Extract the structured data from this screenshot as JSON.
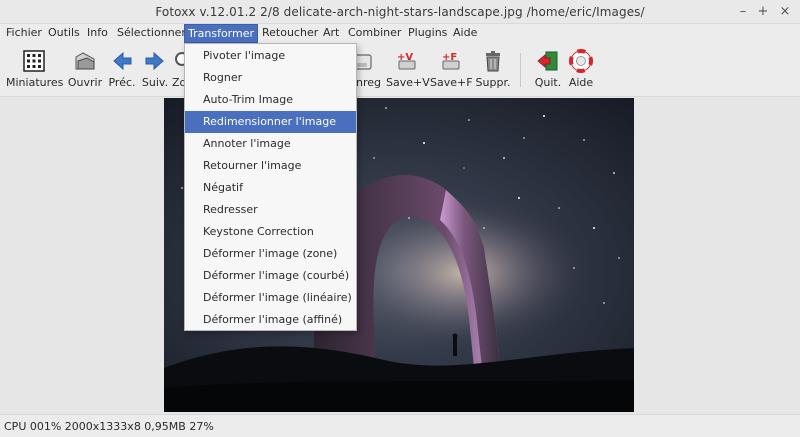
{
  "window": {
    "title": "Fotoxx v.12.01.2  2/8  delicate-arch-night-stars-landscape.jpg  /home/eric/Images/",
    "controls": [
      "–",
      "+",
      "×"
    ]
  },
  "menubar": [
    "Fichier",
    "Outils",
    "Info",
    "Sélectionner",
    "Transformer",
    "Retoucher",
    "Art",
    "Combiner",
    "Plugins",
    "Aide"
  ],
  "toolbar": {
    "miniatures": "Miniatures",
    "ouvrir": "Ouvrir",
    "prec": "Préc.",
    "suiv": "Suiv.",
    "zoom_partial": "Zo",
    "enreg_partial": "nreg.",
    "save_v": "Save+V",
    "save_f": "Save+F",
    "suppr": "Suppr.",
    "quit": "Quit.",
    "aide": "Aide"
  },
  "dropdown": {
    "items": [
      "Pivoter l'image",
      "Rogner",
      "Auto-Trim Image",
      "Redimensionner l'image",
      "Annoter l'image",
      "Retourner l'image",
      "Négatif",
      "Redresser",
      "Keystone Correction",
      "Déformer l'image (zone)",
      "Déformer l'image (courbé)",
      "Déformer l'image (linéaire)",
      "Déformer l'image (affiné)"
    ],
    "highlighted_index": 3
  },
  "status": "CPU 001%  2000x1333x8 0,95MB 27%",
  "colors": {
    "accent": "#4a6fbe",
    "save_red": "#d8262c"
  }
}
